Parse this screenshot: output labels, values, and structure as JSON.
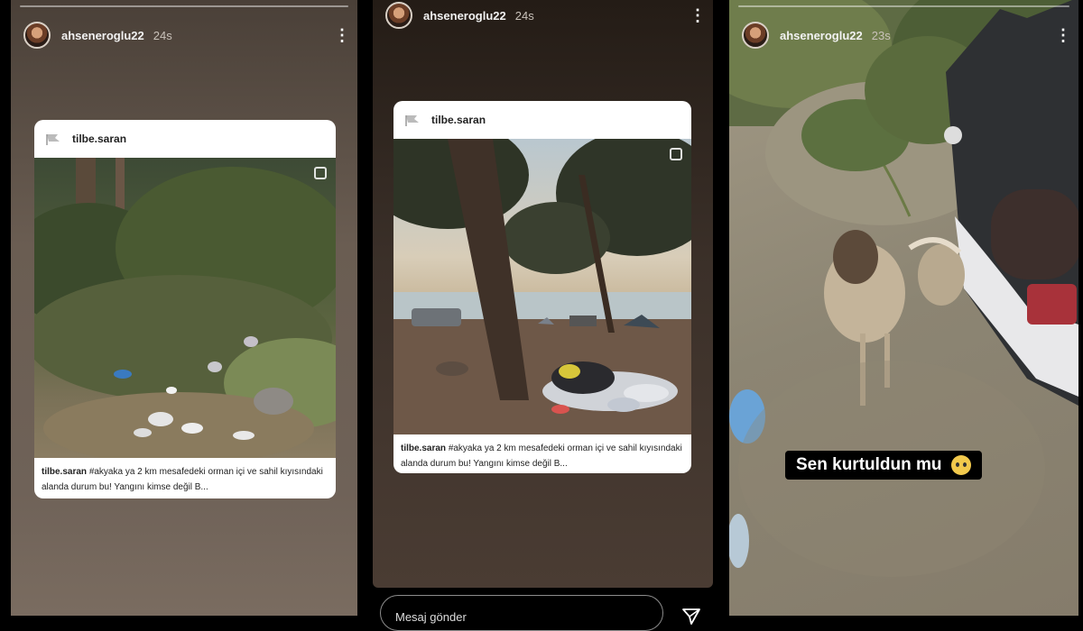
{
  "stories": [
    {
      "username": "ahseneroglu22",
      "time": "24s",
      "shared_post": {
        "username": "tilbe.saran",
        "caption_user": "tilbe.saran",
        "caption_text": "#akyaka ya 2 km mesafedeki orman içi ve sahil kıyısındaki alanda durum bu! Yangını kimse değil B..."
      }
    },
    {
      "username": "ahseneroglu22",
      "time": "24s",
      "shared_post": {
        "username": "tilbe.saran",
        "caption_user": "tilbe.saran",
        "caption_text": "#akyaka ya 2 km mesafedeki orman içi ve sahil kıyısındaki alanda durum bu! Yangını kimse değil B..."
      },
      "message_placeholder": "Mesaj gönder"
    },
    {
      "username": "ahseneroglu22",
      "time": "23s",
      "sticker_text": "Sen kurtuldun mu"
    }
  ],
  "icons": {
    "more": "more-vertical-icon",
    "send": "paper-plane-icon",
    "multi": "multiple-photos-icon",
    "emoji": "pleading-face-emoji"
  }
}
